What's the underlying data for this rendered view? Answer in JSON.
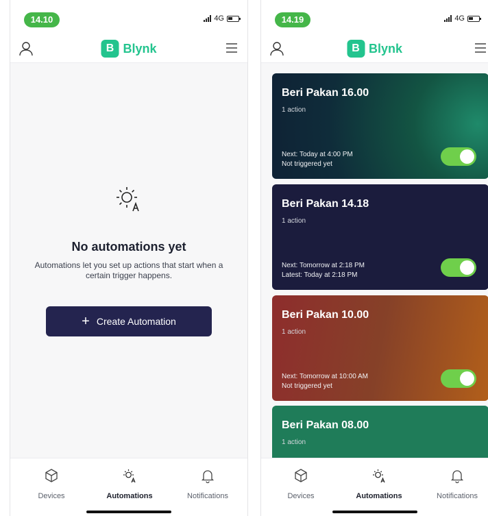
{
  "left_screen": {
    "status": {
      "time": "14.10",
      "network": "4G"
    },
    "header": {
      "brand_letter": "B",
      "brand_name": "Blynk"
    },
    "empty_state": {
      "title": "No automations yet",
      "description": "Automations let you set up actions that start when a certain trigger happens.",
      "button_label": "Create Automation"
    },
    "tabs": [
      {
        "label": "Devices",
        "icon": "cube-icon",
        "active": false
      },
      {
        "label": "Automations",
        "icon": "automation-icon",
        "active": true
      },
      {
        "label": "Notifications",
        "icon": "bell-icon",
        "active": false
      }
    ]
  },
  "right_screen": {
    "status": {
      "time": "14.19",
      "network": "4G"
    },
    "header": {
      "brand_letter": "B",
      "brand_name": "Blynk"
    },
    "automations": [
      {
        "title": "Beri Pakan 16.00",
        "actions": "1 action",
        "line1": "Next: Today at 4:00 PM",
        "line2": "Not triggered yet",
        "enabled": true
      },
      {
        "title": "Beri Pakan 14.18",
        "actions": "1 action",
        "line1": "Next: Tomorrow at 2:18 PM",
        "line2": "Latest: Today at 2:18 PM",
        "enabled": true
      },
      {
        "title": "Beri Pakan 10.00",
        "actions": "1 action",
        "line1": "Next: Tomorrow at 10:00 AM",
        "line2": "Not triggered yet",
        "enabled": true
      },
      {
        "title": "Beri Pakan 08.00",
        "actions": "1 action"
      }
    ],
    "tabs": [
      {
        "label": "Devices",
        "icon": "cube-icon",
        "active": false
      },
      {
        "label": "Automations",
        "icon": "automation-icon",
        "active": true
      },
      {
        "label": "Notifications",
        "icon": "bell-icon",
        "active": false
      }
    ]
  },
  "colors": {
    "brand": "#23c48e",
    "time_pill": "#45b649",
    "primary_button": "#24244f",
    "toggle_on": "#6fcf4b"
  }
}
